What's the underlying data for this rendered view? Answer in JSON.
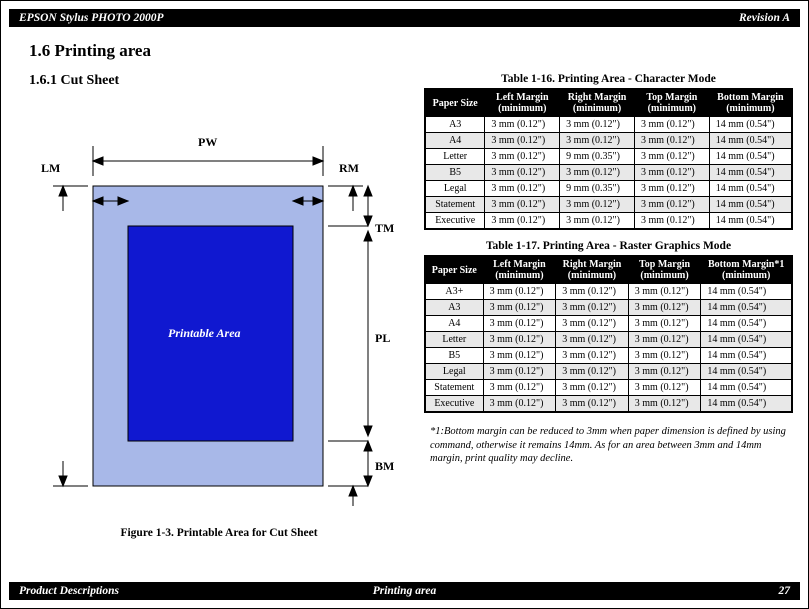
{
  "header": {
    "title": "EPSON Stylus PHOTO 2000P",
    "revision": "Revision A"
  },
  "footer": {
    "left": "Product Descriptions",
    "center": "Printing area",
    "right": "27"
  },
  "section": {
    "num_title": "1.6  Printing area",
    "sub_title": "1.6.1  Cut Sheet"
  },
  "figure": {
    "caption": "Figure 1-3.  Printable Area for Cut Sheet",
    "labels": {
      "PW": "PW",
      "LM": "LM",
      "RM": "RM",
      "TM": "TM",
      "PL": "PL",
      "BM": "BM",
      "printable": "Printable Area"
    }
  },
  "tables": {
    "charMode": {
      "caption": "Table 1-16.  Printing Area - Character Mode",
      "headers": [
        "Paper Size",
        "Left Margin (minimum)",
        "Right Margin (minimum)",
        "Top Margin (minimum)",
        "Bottom Margin (minimum)"
      ],
      "rows": [
        [
          "A3",
          "3 mm (0.12\")",
          "3 mm (0.12\")",
          "3 mm (0.12\")",
          "14 mm (0.54\")"
        ],
        [
          "A4",
          "3 mm (0.12\")",
          "3 mm (0.12\")",
          "3 mm (0.12\")",
          "14 mm (0.54\")"
        ],
        [
          "Letter",
          "3 mm (0.12\")",
          "9 mm (0.35\")",
          "3 mm (0.12\")",
          "14 mm (0.54\")"
        ],
        [
          "B5",
          "3 mm (0.12\")",
          "3 mm (0.12\")",
          "3 mm (0.12\")",
          "14 mm (0.54\")"
        ],
        [
          "Legal",
          "3 mm (0.12\")",
          "9 mm (0.35\")",
          "3 mm (0.12\")",
          "14 mm (0.54\")"
        ],
        [
          "Statement",
          "3 mm (0.12\")",
          "3 mm (0.12\")",
          "3 mm (0.12\")",
          "14 mm (0.54\")"
        ],
        [
          "Executive",
          "3 mm (0.12\")",
          "3 mm (0.12\")",
          "3 mm (0.12\")",
          "14 mm (0.54\")"
        ]
      ]
    },
    "rasterMode": {
      "caption": "Table 1-17.  Printing Area - Raster Graphics Mode",
      "headers": [
        "Paper Size",
        "Left Margin (minimum)",
        "Right Margin (minimum)",
        "Top Margin (minimum)",
        "Bottom Margin*1 (minimum)"
      ],
      "rows": [
        [
          "A3+",
          "3 mm (0.12\")",
          "3 mm (0.12\")",
          "3 mm (0.12\")",
          "14 mm (0.54\")"
        ],
        [
          "A3",
          "3 mm (0.12\")",
          "3 mm (0.12\")",
          "3 mm (0.12\")",
          "14 mm (0.54\")"
        ],
        [
          "A4",
          "3 mm (0.12\")",
          "3 mm (0.12\")",
          "3 mm (0.12\")",
          "14 mm (0.54\")"
        ],
        [
          "Letter",
          "3 mm (0.12\")",
          "3 mm (0.12\")",
          "3 mm (0.12\")",
          "14 mm (0.54\")"
        ],
        [
          "B5",
          "3 mm (0.12\")",
          "3 mm (0.12\")",
          "3 mm (0.12\")",
          "14 mm (0.54\")"
        ],
        [
          "Legal",
          "3 mm (0.12\")",
          "3 mm (0.12\")",
          "3 mm (0.12\")",
          "14 mm (0.54\")"
        ],
        [
          "Statement",
          "3 mm (0.12\")",
          "3 mm (0.12\")",
          "3 mm (0.12\")",
          "14 mm (0.54\")"
        ],
        [
          "Executive",
          "3 mm (0.12\")",
          "3 mm (0.12\")",
          "3 mm (0.12\")",
          "14 mm (0.54\")"
        ]
      ]
    }
  },
  "footnote": "*1:Bottom margin can be reduced to 3mm when paper dimension is defined by using command, otherwise it remains 14mm. As for an area between 3mm and 14mm margin, print quality may decline."
}
